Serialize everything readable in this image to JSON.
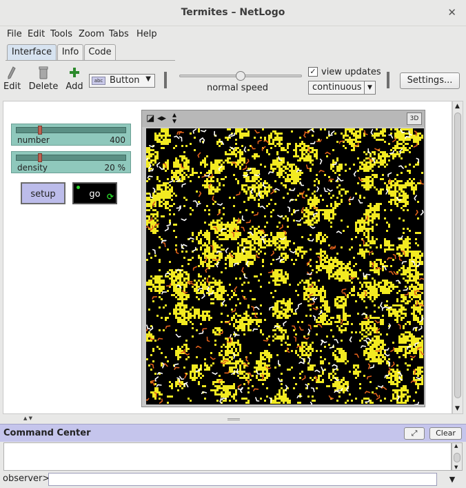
{
  "window": {
    "title": "Termites – NetLogo",
    "close_glyph": "✕"
  },
  "menu": {
    "items": [
      "File",
      "Edit",
      "Tools",
      "Zoom",
      "Tabs",
      "Help"
    ]
  },
  "tabs": [
    {
      "label": "Interface",
      "active": true
    },
    {
      "label": "Info",
      "active": false
    },
    {
      "label": "Code",
      "active": false
    }
  ],
  "toolbar": {
    "edit_label": "Edit",
    "delete_label": "Delete",
    "add_label": "Add",
    "widget_type_badge": "abc",
    "widget_type": "Button",
    "speed_label": "normal speed",
    "speed_fraction": 0.5,
    "view_updates_label": "view updates",
    "view_updates_checked": true,
    "update_mode": "continuous",
    "settings_label": "Settings..."
  },
  "widgets": {
    "sliders": [
      {
        "name": "number",
        "value": "400",
        "fraction": 0.2
      },
      {
        "name": "density",
        "value": "20 %",
        "fraction": 0.2
      }
    ],
    "setup_label": "setup",
    "go_label": "go"
  },
  "view": {
    "btn_3d": "3D"
  },
  "command_center": {
    "title": "Command Center",
    "clear_label": "Clear",
    "observer_label": "observer>",
    "command_value": ""
  },
  "colors": {
    "wood_chip": "#f2ea21",
    "termite_empty": "#ffffff",
    "termite_carrying": "#e0601a",
    "background": "#000000",
    "slider_bg": "#8fc8bc",
    "setup_bg": "#bcbcea",
    "command_center_bg": "#c5c5ec"
  }
}
